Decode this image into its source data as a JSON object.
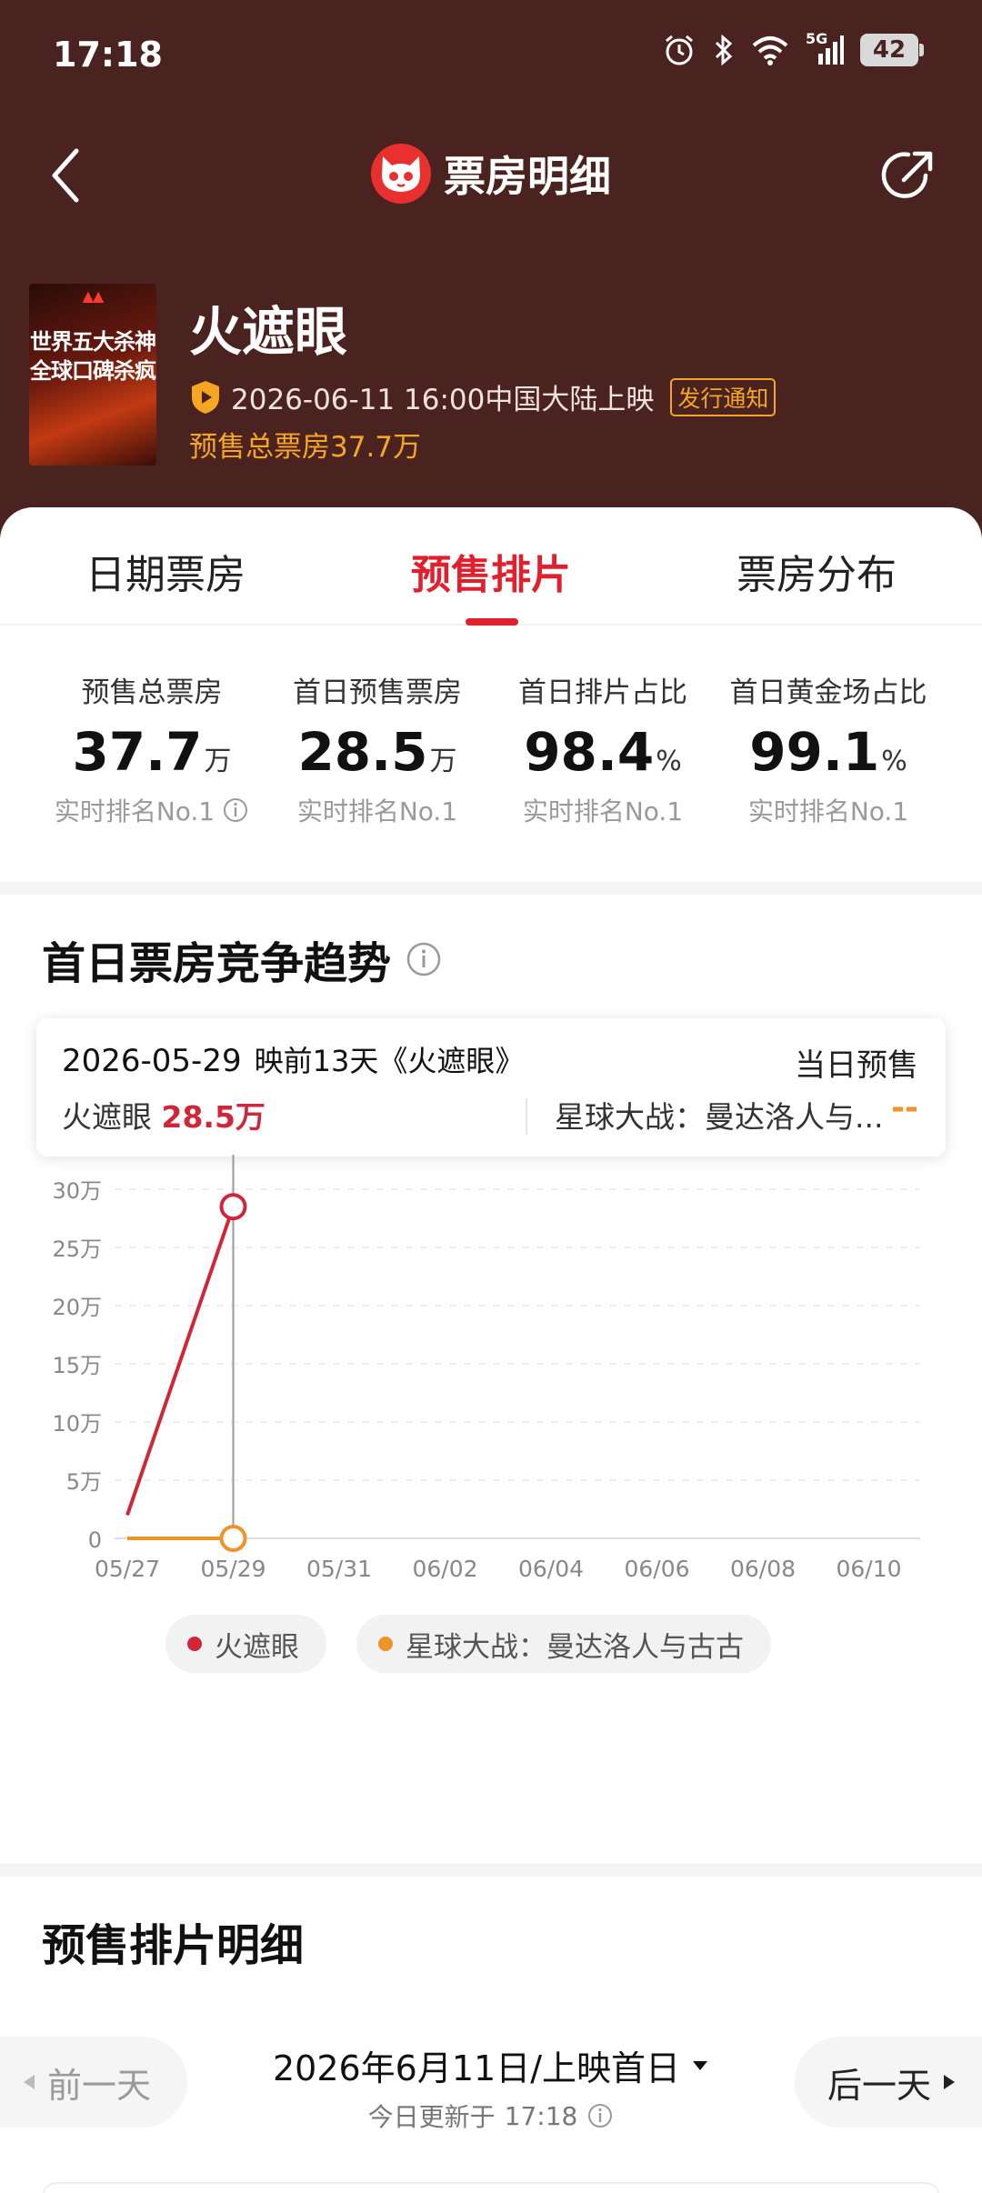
{
  "status_bar": {
    "time": "17:18",
    "network": "5G",
    "battery": "42"
  },
  "nav": {
    "title": "票房明细"
  },
  "movie": {
    "title": "火遮眼",
    "poster_text": [
      "世界五大杀神",
      "全球口碑杀疯"
    ],
    "release_text": "2026-06-11 16:00中国大陆上映",
    "release_badge": "发行通知",
    "presale_total": "预售总票房37.7万"
  },
  "tabs": [
    {
      "label": "日期票房",
      "active": false
    },
    {
      "label": "预售排片",
      "active": true
    },
    {
      "label": "票房分布",
      "active": false
    }
  ],
  "stats": [
    {
      "label": "预售总票房",
      "value": "37.7",
      "unit": "万",
      "rank": "实时排名No.1"
    },
    {
      "label": "首日预售票房",
      "value": "28.5",
      "unit": "万",
      "rank": "实时排名No.1"
    },
    {
      "label": "首日排片占比",
      "value": "98.4",
      "unit": "%",
      "rank": "实时排名No.1"
    },
    {
      "label": "首日黄金场占比",
      "value": "99.1",
      "unit": "%",
      "rank": "实时排名No.1"
    }
  ],
  "trend": {
    "title": "首日票房竞争趋势",
    "tooltip": {
      "date": "2026-05-29",
      "days_text": "映前13天《火遮眼》",
      "right_label": "当日预售",
      "movie1_name": "火遮眼",
      "movie1_value": "28.5万",
      "movie2_name": "星球大战：曼达洛人与...",
      "movie2_value": "--"
    }
  },
  "chart_data": {
    "type": "line",
    "x": [
      "05/27",
      "05/29",
      "05/31",
      "06/02",
      "06/04",
      "06/06",
      "06/08",
      "06/10"
    ],
    "y_ticks": [
      "0",
      "5万",
      "10万",
      "15万",
      "20万",
      "25万",
      "30万"
    ],
    "ylim": [
      0,
      30
    ],
    "y_unit": "万",
    "series": [
      {
        "name": "火遮眼",
        "color": "#d0263a",
        "points": [
          [
            "05/27",
            2
          ],
          [
            "05/29",
            28.5
          ]
        ]
      },
      {
        "name": "星球大战：曼达洛人与古古",
        "color": "#f0922a",
        "points": [
          [
            "05/27",
            0
          ],
          [
            "05/29",
            0
          ]
        ]
      }
    ],
    "highlight_x": "05/29",
    "grid": true
  },
  "details": {
    "title": "预售排片明细",
    "prev_label": "前一天",
    "next_label": "后一天",
    "date_label": "2026年6月11日/上映首日",
    "update_prefix": "今日更新于",
    "update_time": "17:18"
  }
}
